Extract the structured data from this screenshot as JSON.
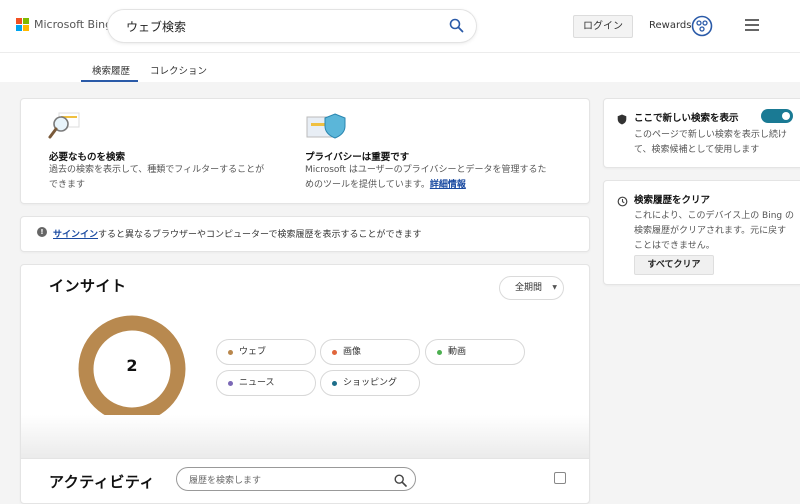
{
  "header": {
    "logo_text": "Microsoft Bing",
    "search_value": "ウェブ検索",
    "login_label": "ログイン",
    "rewards_label": "Rewards"
  },
  "tabs": [
    {
      "label": "検索履歴",
      "active": true
    },
    {
      "label": "コレクション",
      "active": false
    }
  ],
  "features": [
    {
      "title": "必要なものを検索",
      "desc_line1": "過去の検索を表示して、種類でフィルターすることが",
      "desc_line2": "できます"
    },
    {
      "title": "プライバシーは重要です",
      "desc_line1": "Microsoft はユーザーのプライバシーとデータを管理するた",
      "desc_line2": "めのツールを提供しています。",
      "link": "詳細情報"
    }
  ],
  "signin_notice": {
    "link": "サインイン",
    "text": "すると異なるブラウザーやコンピューターで検索履歴を表示することができます"
  },
  "insights": {
    "title": "インサイト",
    "period": "全期間",
    "count": "2",
    "categories": [
      {
        "label": "ウェブ",
        "color": "#b9874c"
      },
      {
        "label": "画像",
        "color": "#e0663b"
      },
      {
        "label": "動画",
        "color": "#4caf50"
      },
      {
        "label": "ニュース",
        "color": "#7b68b6"
      },
      {
        "label": "ショッピング",
        "color": "#1d6e8a"
      }
    ],
    "donut_color": "#b8894f"
  },
  "activity": {
    "title": "アクティビティ",
    "search_placeholder": "履歴を検索します"
  },
  "right_panel": {
    "new_search": {
      "title": "ここで新しい検索を表示",
      "desc": "このページで新しい検索を表示し続けて、検索候補として使用します",
      "toggle_on": true
    },
    "clear": {
      "title": "検索履歴をクリア",
      "desc": "これにより、このデバイス上の Bing の検索履歴がクリアされます。元に戻すことはできません。",
      "button": "すべてクリア"
    }
  },
  "colors": {
    "accent": "#1a7a94",
    "link": "#1a4aa1",
    "tab_underline": "#2a5aa8"
  }
}
